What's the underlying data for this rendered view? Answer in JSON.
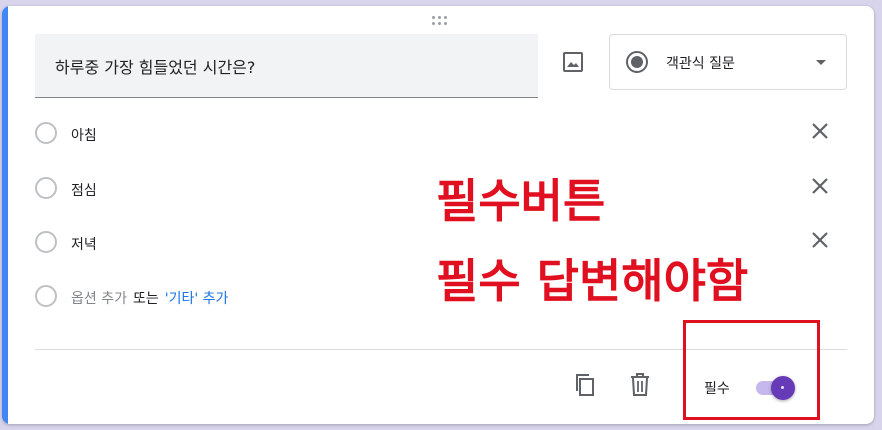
{
  "question": {
    "title": "하루중 가장 힘들었던 시간은?",
    "type_label": "객관식 질문"
  },
  "options": [
    {
      "label": "아침"
    },
    {
      "label": "점심"
    },
    {
      "label": "저녁"
    }
  ],
  "add_row": {
    "add_option": "옵션 추가",
    "or": "또는",
    "add_other": "'기타' 추가"
  },
  "footer": {
    "required_label": "필수",
    "required_on": true
  },
  "annotation": {
    "line1": "필수버튼",
    "line2": "필수 답변해야함"
  },
  "colors": {
    "accent": "#4285f4",
    "toggle": "#673ab7",
    "annotation": "#e01020",
    "link": "#1a73e8"
  },
  "icons": [
    "drag-handle-icon",
    "image-icon",
    "radio-button-icon",
    "dropdown-arrow-icon",
    "close-icon",
    "copy-icon",
    "delete-icon"
  ]
}
